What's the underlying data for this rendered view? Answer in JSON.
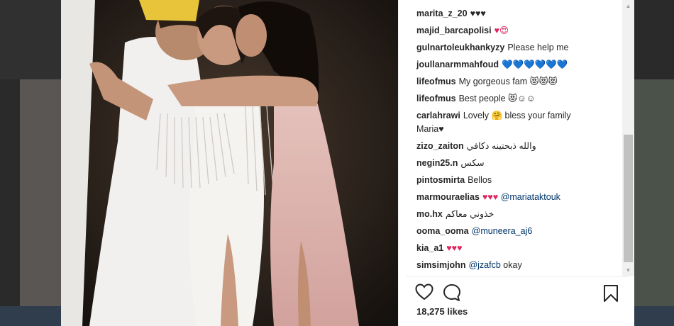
{
  "post": {
    "likes": "18,275 likes"
  },
  "comments": [
    {
      "user": "marita_z_20",
      "text": "♥♥♥"
    },
    {
      "user": "majid_barcapolisi",
      "text": "♥😍"
    },
    {
      "user": "gulnartoleukhankyzy",
      "text": "Please help me"
    },
    {
      "user": "joullanarmmahfoud",
      "text": "💙💙💙💙💙💙"
    },
    {
      "user": "lifeofmus",
      "text": "My gorgeous fam 😻😻😻"
    },
    {
      "user": "lifeofmus",
      "text": "Best people 😻☺☺"
    },
    {
      "user": "carlahrawi",
      "text": "Lovely 🤗 bless your family",
      "text2": "Maria♥"
    },
    {
      "user": "zizo_zaiton",
      "text": "والله ذبحتينه دكافي",
      "rtl": true
    },
    {
      "user": "negin25.n",
      "text": "سکس",
      "rtl": true
    },
    {
      "user": "pintosmirta",
      "text": "Bellos"
    },
    {
      "user": "marmouraelias",
      "text": "♥♥♥",
      "mention": "@mariataktouk"
    },
    {
      "user": "mo.hx",
      "text": "خذوني معاكم",
      "rtl": true
    },
    {
      "user": "ooma_ooma",
      "text": "",
      "mention": "@muneera_aj6"
    },
    {
      "user": "kia_a1",
      "text": "♥♥♥"
    },
    {
      "user": "simsimjohn",
      "text": "okay",
      "mention": "@jzafcb"
    }
  ],
  "icons": {
    "like": "heart-outline-icon",
    "comment": "speech-bubble-icon",
    "save": "bookmark-icon",
    "scroll_up": "▲",
    "scroll_down": "▼"
  },
  "colors": {
    "heart": "#e0245e",
    "blue_heart": "#2ea8e6",
    "mention": "#003569"
  }
}
